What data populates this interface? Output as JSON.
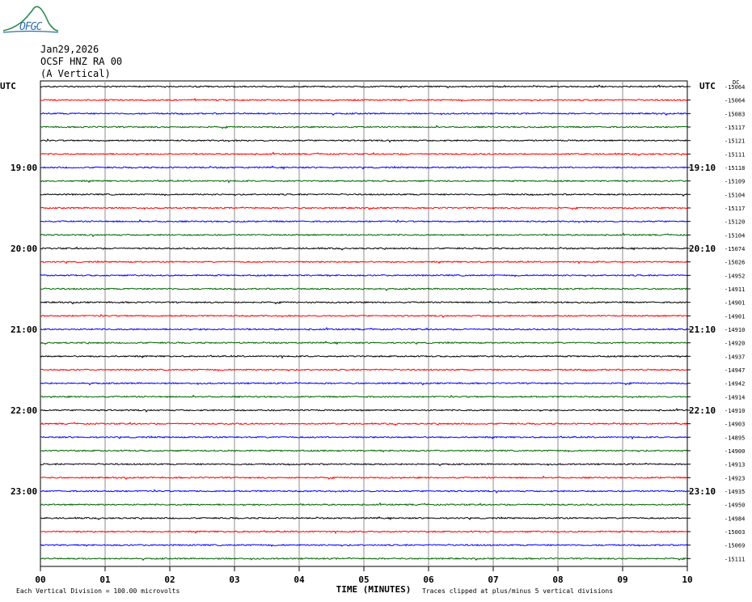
{
  "logo": {
    "text": "OFGC",
    "icon": "mountain-logo-icon",
    "color": "#2e8b57"
  },
  "header": {
    "date": "Jan29,2026",
    "station": "OCSF HNZ RA 00",
    "component": "(A Vertical)"
  },
  "chart_data": {
    "type": "line",
    "title": "Jan29,2026",
    "xlabel": "TIME (MINUTES)",
    "xlim": [
      0,
      10
    ],
    "x_ticks": [
      "00",
      "01",
      "02",
      "03",
      "04",
      "05",
      "06",
      "07",
      "08",
      "09",
      "10"
    ],
    "left_axis_label": "UTC",
    "right_axis_label": "UTC",
    "right_corner_label": "DC",
    "trace_colors": [
      "#000000",
      "#ff0000",
      "#0000ff",
      "#006400"
    ],
    "hour_labels_left": [
      {
        "row": 6,
        "text": "19:00"
      },
      {
        "row": 12,
        "text": "20:00"
      },
      {
        "row": 18,
        "text": "21:00"
      },
      {
        "row": 24,
        "text": "22:00"
      },
      {
        "row": 30,
        "text": "23:00"
      }
    ],
    "hour_labels_right": [
      {
        "row": 6,
        "text": "19:10"
      },
      {
        "row": 12,
        "text": "20:10"
      },
      {
        "row": 18,
        "text": "21:10"
      },
      {
        "row": 24,
        "text": "22:10"
      },
      {
        "row": 30,
        "text": "23:10"
      }
    ],
    "dc_offsets": [
      "-15064",
      "-15064",
      "-15083",
      "-15117",
      "-15121",
      "-15111",
      "-15118",
      "-15109",
      "-15104",
      "-15117",
      "-15120",
      "-15104",
      "-15074",
      "-15026",
      "-14952",
      "-14911",
      "-14901",
      "-14901",
      "-14910",
      "-14920",
      "-14937",
      "-14947",
      "-14942",
      "-14914",
      "-14910",
      "-14903",
      "-14895",
      "-14900",
      "-14913",
      "-14923",
      "-14935",
      "-14950",
      "-14984",
      "-15003",
      "-15069",
      "-15111"
    ],
    "footer_left": "Each Vertical Division =  100.00 microvolts",
    "footer_right": "Traces clipped at plus/minus 5 vertical divisions"
  }
}
